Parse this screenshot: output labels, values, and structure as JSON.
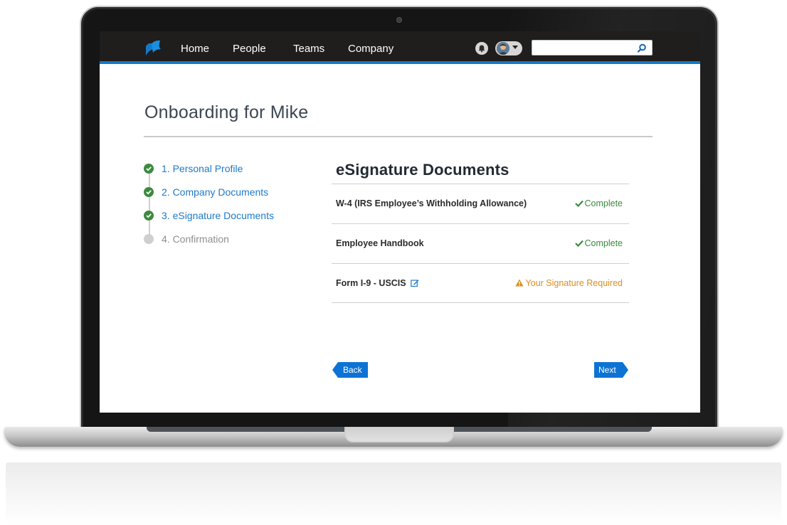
{
  "nav": {
    "items": [
      {
        "label": "Home"
      },
      {
        "label": "People"
      },
      {
        "label": "Teams"
      },
      {
        "label": "Company"
      }
    ],
    "search": {
      "value": "",
      "placeholder": ""
    },
    "icons": {
      "logo": "app-logo-icon",
      "bell": "bell-icon",
      "avatar": "user-avatar",
      "search": "search-icon"
    }
  },
  "page": {
    "title": "Onboarding for Mike"
  },
  "steps": [
    {
      "label": "1. Personal Profile",
      "status": "done"
    },
    {
      "label": "2. Company Documents",
      "status": "done"
    },
    {
      "label": "3. eSignature Documents",
      "status": "done"
    },
    {
      "label": "4. Confirmation",
      "status": "todo"
    }
  ],
  "section": {
    "title": "eSignature Documents",
    "documents": [
      {
        "name": "W-4 (IRS Employee’s Withholding Allowance)",
        "status": "Complete",
        "state": "complete"
      },
      {
        "name": "Employee Handbook",
        "status": "Complete",
        "state": "complete"
      },
      {
        "name": "Form I-9 - USCIS",
        "status": "Your Signature Required",
        "state": "required"
      }
    ]
  },
  "buttons": {
    "back": "Back",
    "next": "Next"
  },
  "colors": {
    "nav_bg": "#201d1d",
    "accent_blue": "#1379c7",
    "complete_green": "#3c8a3e",
    "warning_orange": "#dd8e1c",
    "button_blue": "#0c73d4"
  }
}
